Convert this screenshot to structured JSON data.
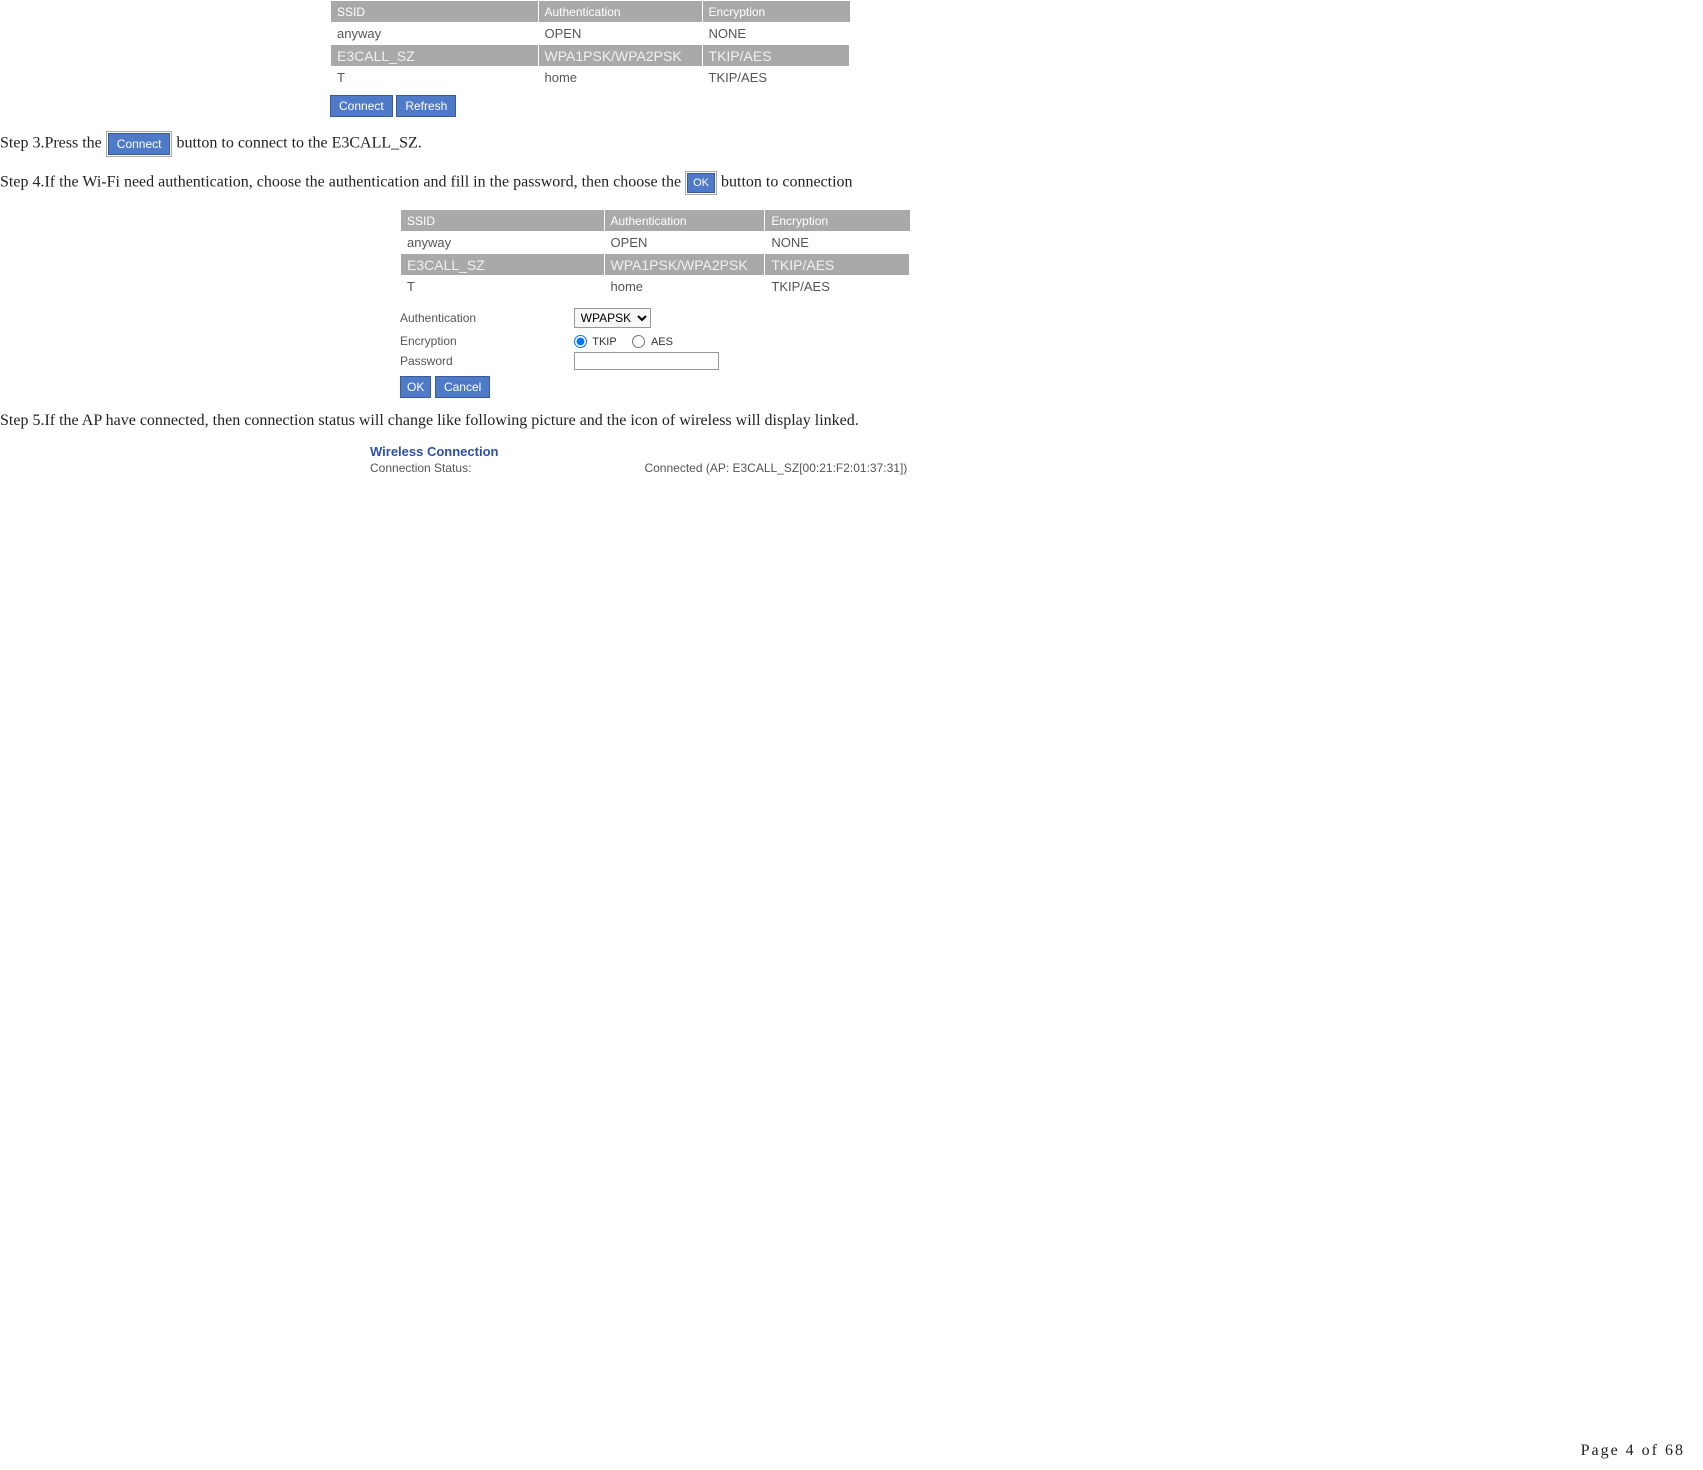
{
  "table": {
    "headers": {
      "ssid": "SSID",
      "auth": "Authentication",
      "enc": "Encryption"
    },
    "rows": [
      {
        "ssid": "anyway",
        "auth": "OPEN",
        "enc": "NONE",
        "selected": false
      },
      {
        "ssid": "E3CALL_SZ",
        "auth": "WPA1PSK/WPA2PSK",
        "enc": "TKIP/AES",
        "selected": true
      },
      {
        "ssid": "T",
        "auth": "home",
        "enc": "TKIP/AES",
        "selected": false
      }
    ]
  },
  "buttons": {
    "connect": "Connect",
    "refresh": "Refresh",
    "ok": "OK",
    "cancel": "Cancel"
  },
  "steps": {
    "s3a": "Step 3.Press the ",
    "s3b": " button to connect to the E3CALL_SZ.",
    "s4a": "Step 4.If the Wi-Fi need authentication, choose the authentication and fill in the password, then choose the ",
    "s4b": " button to connection",
    "s5": "Step 5.If the AP have connected, then connection status will change like following picture and the icon of wireless will display linked."
  },
  "form": {
    "auth_label": "Authentication",
    "auth_value": "WPAPSK",
    "enc_label": "Encryption",
    "enc_opt_tkip": "TKIP",
    "enc_opt_aes": "AES",
    "enc_selected": "TKIP",
    "pwd_label": "Password",
    "pwd_value": ""
  },
  "wireless": {
    "title": "Wireless Connection",
    "status_label": "Connection Status:",
    "status_value": "Connected (AP: E3CALL_SZ[00:21:F2:01:37:31])"
  },
  "footer": {
    "page": "Page 4 of 68"
  }
}
